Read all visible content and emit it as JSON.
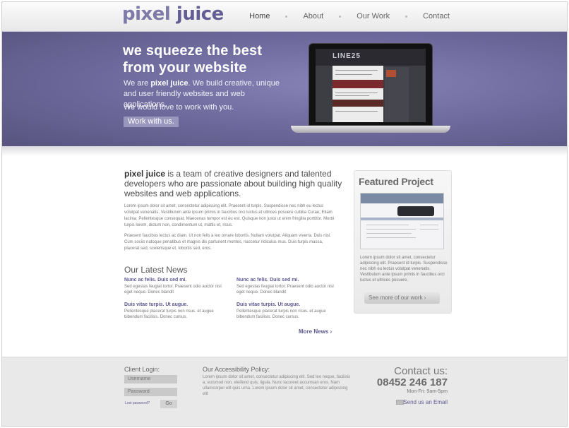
{
  "brand": {
    "logo_word1": "pixel",
    "logo_word2": "juice"
  },
  "nav": {
    "home": "Home",
    "about": "About",
    "work": "Our Work",
    "contact": "Contact"
  },
  "hero": {
    "title_line1": "we squeeze the best",
    "title_line2": "from your website",
    "intro_prefix": "We are ",
    "intro_brand": "pixel juice",
    "intro_rest": ". We build creative, unique and user friendly websites and web applications.",
    "p2": "We would love to work with you.",
    "cta": "Work with us.",
    "laptop_screen_logo": "LINE25"
  },
  "intro": {
    "lead_brand": "pixel juice",
    "lead_rest": " is a team of creative designers and talented developers who are passionate about building high quality websites and web applications.",
    "para1": "Lorem ipsum dolor sit amet, consectetur adipiscing elit. Praesent id turpis. Suspendisse nec nibh eu lectus volutpat venenatis. Vestibulum ante ipsum primis in faucibus orci luctus et ultrices posuere cubilia Curae; Etiam lacinia. Pellentesque consequat. Maecenas tempor est eu est. Quisque non justo ut enim fringilla porttitor. Morbi turpis lorem, dictum non, condimentum ut, mattis et, risus.",
    "para2": "Praesent faucibus lectus ac diam. Ut non felis a leo ornare lobortis. Nullam volutpat. Aliquam viverra. Duis nisi. Cum sociis natoque penatibus et magnis dis parturient montes, nascetur ridiculus mus. Duis turpis massa, placerat sed, scelerisque et, lobortis sed, eros."
  },
  "news": {
    "title": "Our Latest News",
    "items": [
      {
        "head": "Nunc ac felis. Duis sed mi.",
        "text": "Sed egestas feugiat tortor. Praesent odio auctor nisl eget neque. Donec blandit"
      },
      {
        "head": "Nunc ac felis. Duis sed mi.",
        "text": "Sed egestas feugiat tortor. Praesent odio auctor nisl eget neque. Donec blandit"
      },
      {
        "head": "Duis vitae turpis. Ut augue.",
        "text": "Pellentesque placerat turpis non risus. et augue bibendum facilisis. Donec cursus."
      },
      {
        "head": "Duis vitae turpis. Ut augue.",
        "text": "Pellentesque placerat turpis non risus. et augue bibendum facilisis. Donec cursus."
      }
    ],
    "more": "More News ›"
  },
  "featured": {
    "title": "Featured Project",
    "text": "Lorem ipsum dolor sit amet, consectetur adipiscing elit. Praesent id turpis. Suspendisse nec nibh eu lectus volutpat venenatis. Vestibulum ante ipsum primis in faucibus orci luctus et ultrices posuere.",
    "button": "See more of our work ›"
  },
  "footer": {
    "client_login": "Client Login:",
    "username_placeholder": "Username",
    "password_placeholder": "Password",
    "lost_password": "Lost password?",
    "go": "Go",
    "accessibility_title": "Our Accessibility Policy:",
    "accessibility_text": "Lorem ipsum dolor sit amet, consectetur adipiscing elit. Sed leo neque, facilisis a, euismod non, eleifend quis, ligula. Nunc lacoreet accumsan eros. Nam ullamcorper elit quis urna. Lorem ipsum dolor sit amet, consectetur adipiscing elit",
    "contact_title": "Contact us:",
    "phone": "08452 246 187",
    "hours": "Mon-Fri: 9am-5pm",
    "email_link": "Send us an Email"
  },
  "colors": {
    "brand": "#625e93",
    "hero": "#6b6799",
    "link": "#5e5a92"
  }
}
